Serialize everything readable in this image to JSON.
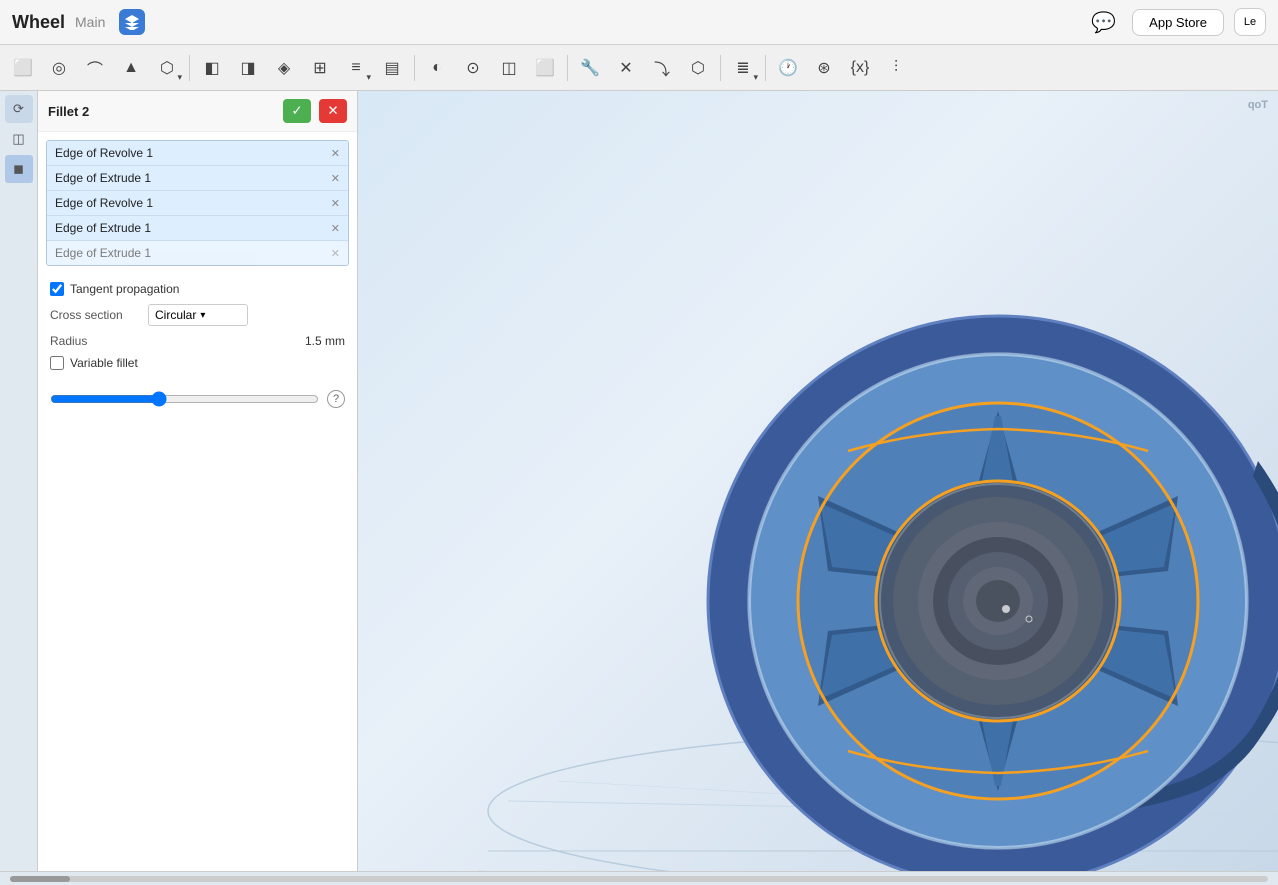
{
  "titlebar": {
    "app_name": "Wheel",
    "branch": "Main",
    "appstore_label": "App Store"
  },
  "toolbar": {
    "icons": [
      "↩",
      "◎",
      "⌒",
      "▲",
      "⬡",
      "⬜",
      "⬛",
      "◈",
      "⊞",
      "≡",
      "▤",
      "◐",
      "⊙",
      "◫",
      "◻",
      "⬜",
      "⊕",
      "⊗",
      "⤵",
      "⊞",
      "≣",
      "⊟",
      "⊡",
      "⊠",
      "◳",
      "✕",
      "⊕",
      "⧖",
      "⊛",
      "{x}",
      "⫶"
    ]
  },
  "fillet_panel": {
    "title": "Fillet 2",
    "confirm_label": "✓",
    "cancel_label": "✕",
    "edges": [
      {
        "id": 1,
        "label": "Edge of Revolve 1"
      },
      {
        "id": 2,
        "label": "Edge of Extrude 1"
      },
      {
        "id": 3,
        "label": "Edge of Revolve 1"
      },
      {
        "id": 4,
        "label": "Edge of Extrude 1"
      }
    ],
    "tangent_propagation": {
      "label": "Tangent propagation",
      "checked": true
    },
    "cross_section": {
      "label": "Cross section",
      "value": "Circular"
    },
    "radius": {
      "label": "Radius",
      "value": "1.5 mm"
    },
    "variable_fillet": {
      "label": "Variable fillet",
      "checked": false
    }
  },
  "viewport": {
    "corner_label": "qoT"
  }
}
